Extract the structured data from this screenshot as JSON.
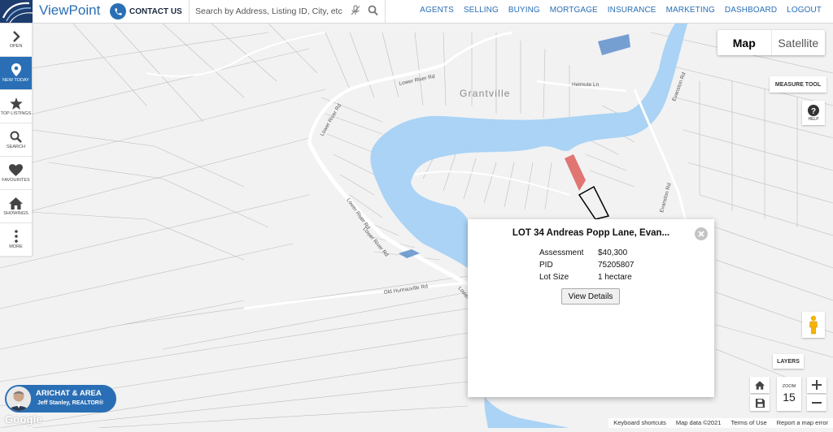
{
  "header": {
    "brand": "ViewPoint",
    "contact_label": "CONTACT US",
    "search_placeholder": "Search by Address, Listing ID, City, etc",
    "nav": [
      "AGENTS",
      "SELLING",
      "BUYING",
      "MORTGAGE",
      "INSURANCE",
      "MARKETING",
      "DASHBOARD",
      "LOGOUT"
    ]
  },
  "toolbar": {
    "open": "OPEN",
    "new_today": "NEW TODAY",
    "top_listings": "TOP LISTINGS",
    "search": "SEARCH",
    "favourites": "FAVOURITES",
    "showings": "SHOWINGS",
    "more": "MORE"
  },
  "map": {
    "place_label": "Grantville",
    "roads": {
      "lower_river_1": "Lower River Rd",
      "lower_river_2": "Lower River Rd",
      "lower_river_3": "Lower River Rd",
      "lower_river_4": "Lower River Rd",
      "lower_river_5": "Lower R",
      "old_hureauville": "Old Hureauville Rd",
      "helmute": "Helmute Ln",
      "evanston_1": "Evanston Rd",
      "evanston_2": "Evanston Rd"
    },
    "colors": {
      "land": "#f2f2f2",
      "water": "#aad3f5",
      "road": "#ffffff",
      "lot_line": "#b9b9b9",
      "highlight_parcel": "#e07572",
      "blue_parcel": "#5f8fcb"
    }
  },
  "controls": {
    "map": "Map",
    "satellite": "Satellite",
    "measure_tool": "MEASURE TOOL",
    "help": "HELP",
    "layers": "LAYERS",
    "zoom_label": "ZOOM",
    "zoom_value": "15"
  },
  "popup": {
    "title": "LOT 34 Andreas Popp Lane, Evan...",
    "rows": [
      {
        "label": "Assessment",
        "value": "$40,300"
      },
      {
        "label": "PID",
        "value": "75205807"
      },
      {
        "label": "Lot Size",
        "value": "1 hectare"
      }
    ],
    "button": "View Details"
  },
  "agent": {
    "area": "ARICHAT & AREA",
    "name": "Jeff Stanley, REALTOR®"
  },
  "google_logo": "Google",
  "footer": [
    "Keyboard shortcuts",
    "Map data ©2021",
    "Terms of Use",
    "Report a map error"
  ]
}
